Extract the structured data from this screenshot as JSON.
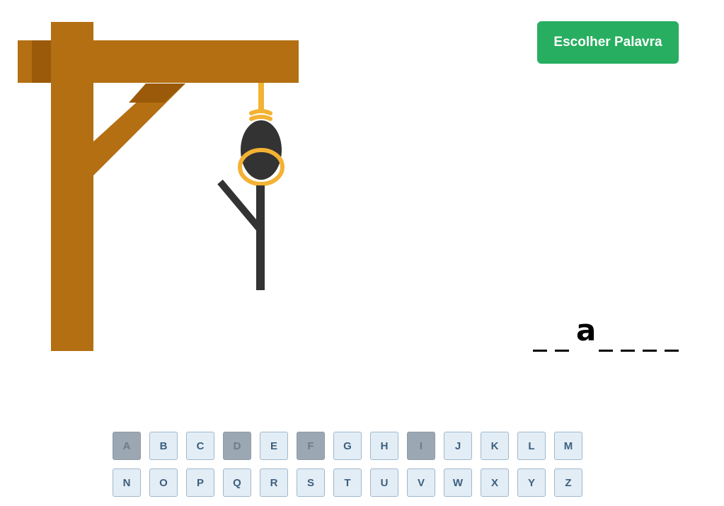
{
  "header": {
    "choose_word_label": "Escolher Palavra"
  },
  "word": {
    "slots": [
      "",
      "",
      "a",
      "",
      "",
      "",
      ""
    ]
  },
  "keyboard": {
    "keys": [
      {
        "letter": "A",
        "used": true
      },
      {
        "letter": "B",
        "used": false
      },
      {
        "letter": "C",
        "used": false
      },
      {
        "letter": "D",
        "used": true
      },
      {
        "letter": "E",
        "used": false
      },
      {
        "letter": "F",
        "used": true
      },
      {
        "letter": "G",
        "used": false
      },
      {
        "letter": "H",
        "used": false
      },
      {
        "letter": "I",
        "used": true
      },
      {
        "letter": "J",
        "used": false
      },
      {
        "letter": "K",
        "used": false
      },
      {
        "letter": "L",
        "used": false
      },
      {
        "letter": "M",
        "used": false
      },
      {
        "letter": "N",
        "used": false
      },
      {
        "letter": "O",
        "used": false
      },
      {
        "letter": "P",
        "used": false
      },
      {
        "letter": "Q",
        "used": false
      },
      {
        "letter": "R",
        "used": false
      },
      {
        "letter": "S",
        "used": false
      },
      {
        "letter": "T",
        "used": false
      },
      {
        "letter": "U",
        "used": false
      },
      {
        "letter": "V",
        "used": false
      },
      {
        "letter": "W",
        "used": false
      },
      {
        "letter": "X",
        "used": false
      },
      {
        "letter": "Y",
        "used": false
      },
      {
        "letter": "Z",
        "used": false
      }
    ]
  },
  "colors": {
    "wood": "#b36f12",
    "wood_shadow": "#9a5a0a",
    "rope": "#f3b233",
    "figure": "#333333",
    "button": "#27ae60",
    "key_bg": "#e3edf6",
    "key_used_bg": "#9ba7b2"
  }
}
